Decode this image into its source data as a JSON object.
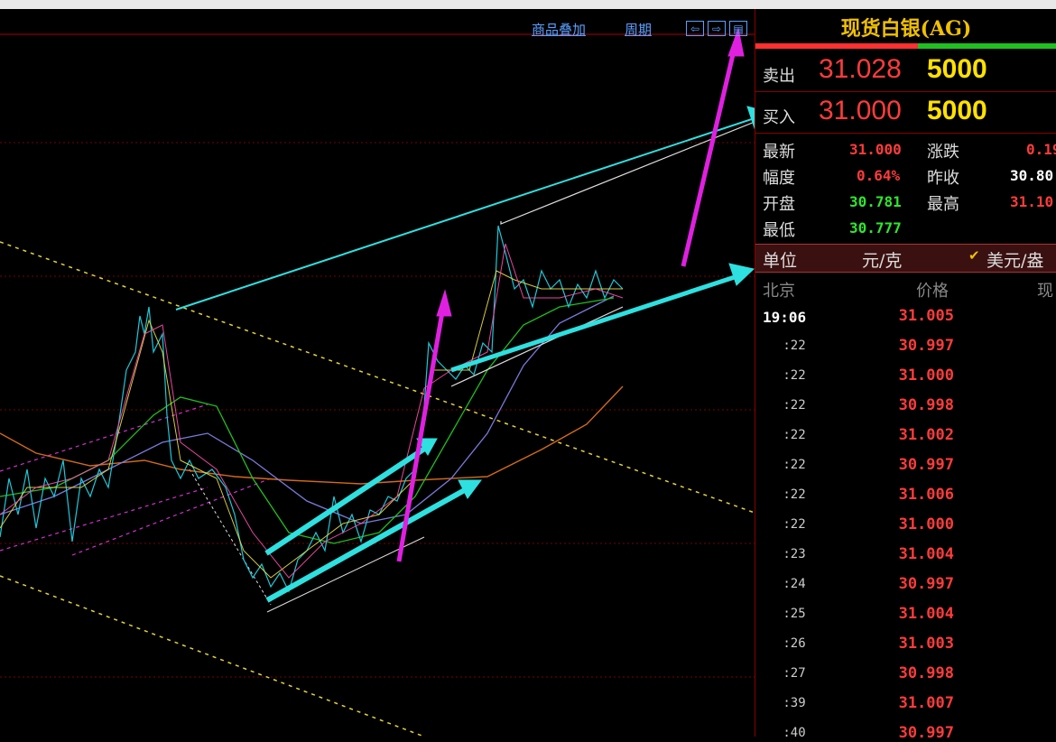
{
  "toolbar": {
    "overlay_label": "商品叠加",
    "period_label": "周期",
    "nav_icons": [
      "arrow-left-icon",
      "arrow-right-icon",
      "window-icon"
    ]
  },
  "panel": {
    "title": "现货白银(AG)",
    "sell": {
      "label": "卖出",
      "price": "31.028",
      "volume": "5000"
    },
    "buy": {
      "label": "买入",
      "price": "31.000",
      "volume": "5000"
    },
    "stats": {
      "latest_label": "最新",
      "latest": "31.000",
      "change_label": "涨跌",
      "change": "0.19",
      "range_label": "幅度",
      "range": "0.64%",
      "prevclose_label": "昨收",
      "prevclose": "30.80",
      "open_label": "开盘",
      "open": "30.781",
      "high_label": "最高",
      "high": "31.10",
      "low_label": "最低",
      "low": "30.777"
    },
    "unit": {
      "label": "单位",
      "value": "元/克",
      "alt_option": "美元/盎",
      "alt_checked": true
    },
    "ticks_header": {
      "time": "北京",
      "price": "价格",
      "vol": "现"
    },
    "ticks": [
      {
        "time": "19:06",
        "price": "31.005"
      },
      {
        "time": ":22",
        "price": "30.997"
      },
      {
        "time": ":22",
        "price": "31.000"
      },
      {
        "time": ":22",
        "price": "30.998"
      },
      {
        "time": ":22",
        "price": "31.002"
      },
      {
        "time": ":22",
        "price": "30.997"
      },
      {
        "time": ":22",
        "price": "31.006"
      },
      {
        "time": ":22",
        "price": "31.000"
      },
      {
        "time": ":23",
        "price": "31.004"
      },
      {
        "time": ":24",
        "price": "30.997"
      },
      {
        "time": ":25",
        "price": "31.004"
      },
      {
        "time": ":26",
        "price": "31.003"
      },
      {
        "time": ":27",
        "price": "30.998"
      },
      {
        "time": ":39",
        "price": "31.007"
      },
      {
        "time": ":40",
        "price": "30.997"
      }
    ]
  },
  "colors": {
    "up": "#ff3b3b",
    "down": "#2ee62e",
    "volume": "#ffe100",
    "title": "#f0c000",
    "grid": "#7a0000"
  }
}
